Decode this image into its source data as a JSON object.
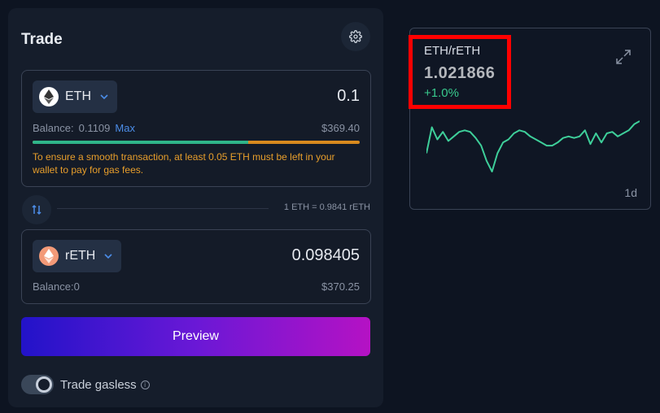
{
  "trade": {
    "title": "Trade",
    "from": {
      "token": "ETH",
      "amount": "0.1",
      "balance_label": "Balance:",
      "balance_value": "0.1109",
      "max_label": "Max",
      "usd_value": "$369.40",
      "progress_fraction": 0.66,
      "warning": "To ensure a smooth transaction, at least 0.05 ETH must be left in your wallet to pay for gas fees."
    },
    "rate": "1 ETH = 0.9841 rETH",
    "to": {
      "token": "rETH",
      "amount": "0.098405",
      "balance_label": "Balance:",
      "balance_value": "0",
      "usd_value": "$370.25"
    },
    "preview_label": "Preview",
    "gasless_label": "Trade gasless",
    "gasless_enabled": true
  },
  "chart_card": {
    "pair": "ETH/rETH",
    "price": "1.021866",
    "change": "+1.0%",
    "period": "1d",
    "line_color": "#3ecf9a"
  },
  "chart_data": {
    "type": "line",
    "series": [
      {
        "values": [
          1.0205,
          1.0222,
          1.0214,
          1.0219,
          1.0213,
          1.0216,
          1.0219,
          1.022,
          1.0219,
          1.0215,
          1.021,
          1.02,
          1.0193,
          1.0205,
          1.0212,
          1.0214,
          1.0218,
          1.022,
          1.0219,
          1.0216,
          1.0214,
          1.0212,
          1.021,
          1.021,
          1.0212,
          1.0215,
          1.0216,
          1.0215,
          1.0216,
          1.022,
          1.0211,
          1.0218,
          1.0212,
          1.0218,
          1.0219,
          1.0216,
          1.0218,
          1.022,
          1.0224,
          1.0226
        ]
      }
    ]
  }
}
